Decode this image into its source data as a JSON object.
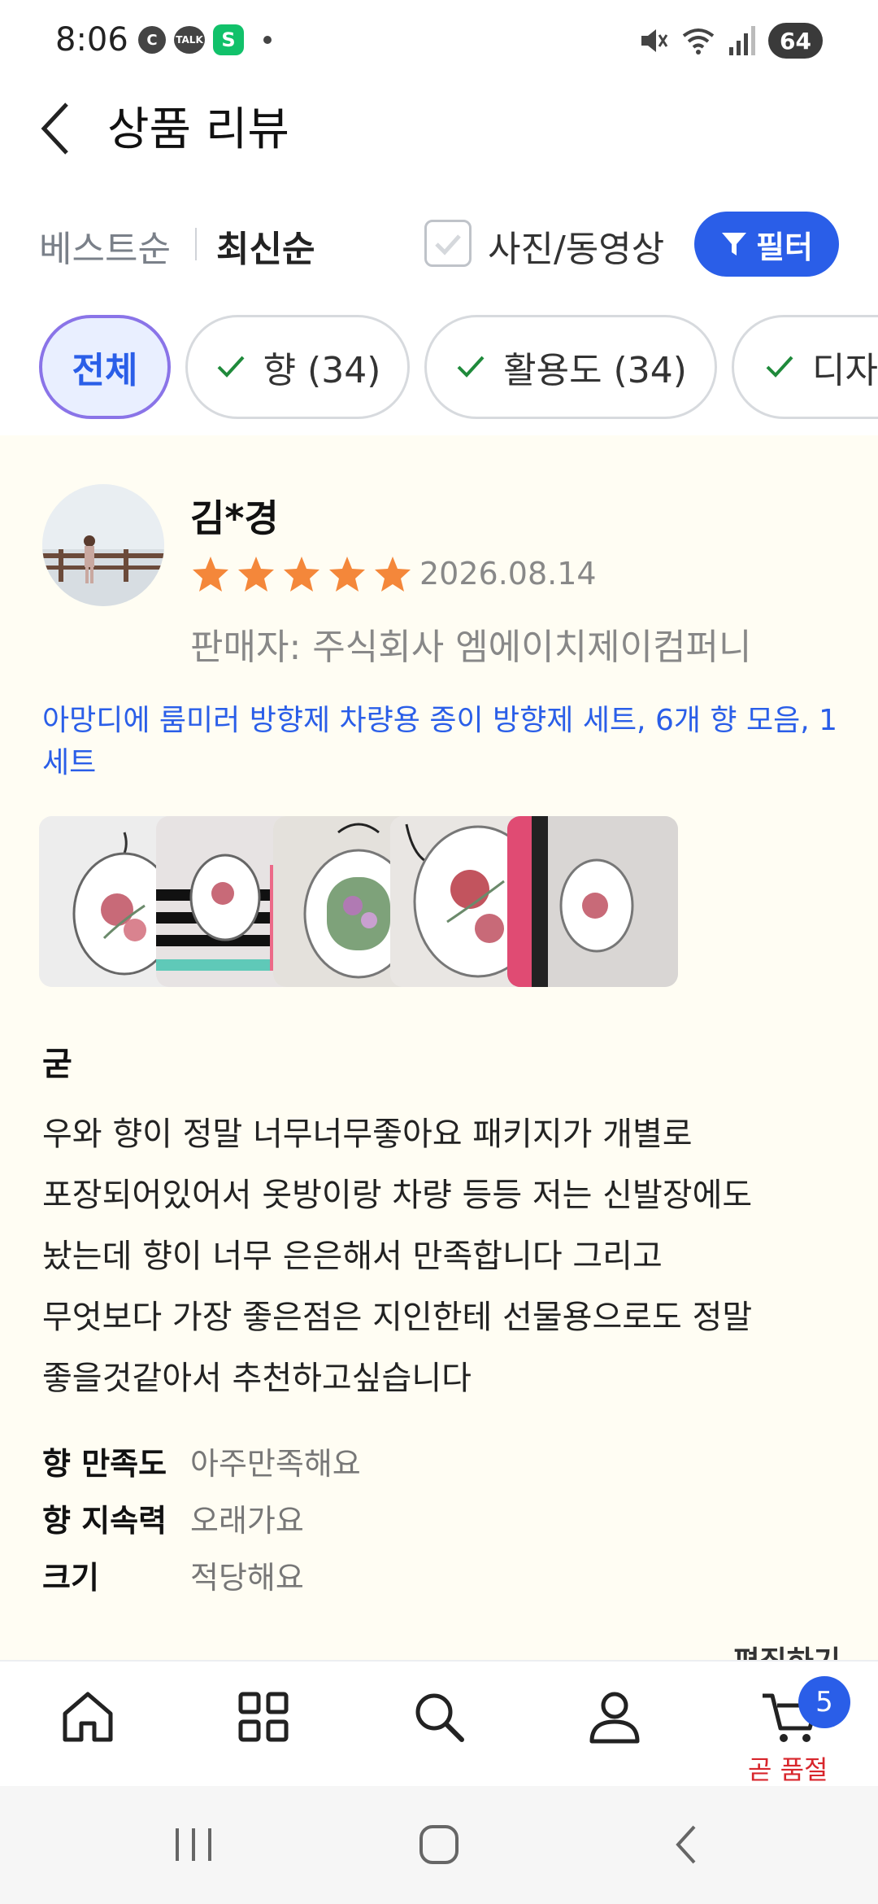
{
  "status_bar": {
    "time": "8:06",
    "icon_c": "C",
    "icon_talk": "TALK",
    "icon_s": "S",
    "battery": "64",
    "icons": [
      "notification-c-icon",
      "kakaotalk-icon",
      "app-s-icon",
      "dot-icon",
      "mute-icon",
      "wifi-icon",
      "signal-icon"
    ]
  },
  "header": {
    "title": "상품 리뷰"
  },
  "sort": {
    "best": "베스트순",
    "newest": "최신순",
    "photo_video": "사진/동영상",
    "filter": "필터"
  },
  "chips": [
    {
      "label": "전체",
      "active": true
    },
    {
      "label": "향 (34)",
      "checked": true
    },
    {
      "label": "활용도 (34)",
      "checked": true
    },
    {
      "label": "디자",
      "checked": true
    }
  ],
  "review": {
    "reviewer": "김*경",
    "rating": 5,
    "date": "2026.08.14",
    "seller": "판매자: 주식회사 엠에이치제이컴퍼니",
    "product": "아망디에 룸미러 방향제 차량용 종이 방향제 세트, 6개 향 모음, 1세트",
    "headline": "굳",
    "body_lines": [
      "우와 향이 정말 너무너무좋아요 패키지가 개별로",
      "포장되어있어서 옷방이랑 차량 등등 저는 신발장에도",
      "놨는데 향이 너무 은은해서 만족합니다 그리고",
      "무엇보다 가장 좋은점은 지인한테 선물용으로도 정말",
      "좋을것같아서 추천하고싶습니다"
    ],
    "attributes": [
      {
        "key": "향 만족도",
        "value": "아주만족해요"
      },
      {
        "key": "향 지속력",
        "value": "오래가요"
      },
      {
        "key": "크기",
        "value": "적당해요"
      }
    ],
    "edit_label": "편집하기"
  },
  "bottom_nav": {
    "items": [
      "home-icon",
      "category-grid-icon",
      "search-icon",
      "my-account-icon",
      "cart-icon"
    ],
    "cart_count": "5",
    "cart_status": "곧 품절"
  },
  "colors": {
    "accent": "#2a5ee8",
    "star": "#f4873a",
    "review_bg": "#fffdf3",
    "soldout": "#d8262c"
  }
}
